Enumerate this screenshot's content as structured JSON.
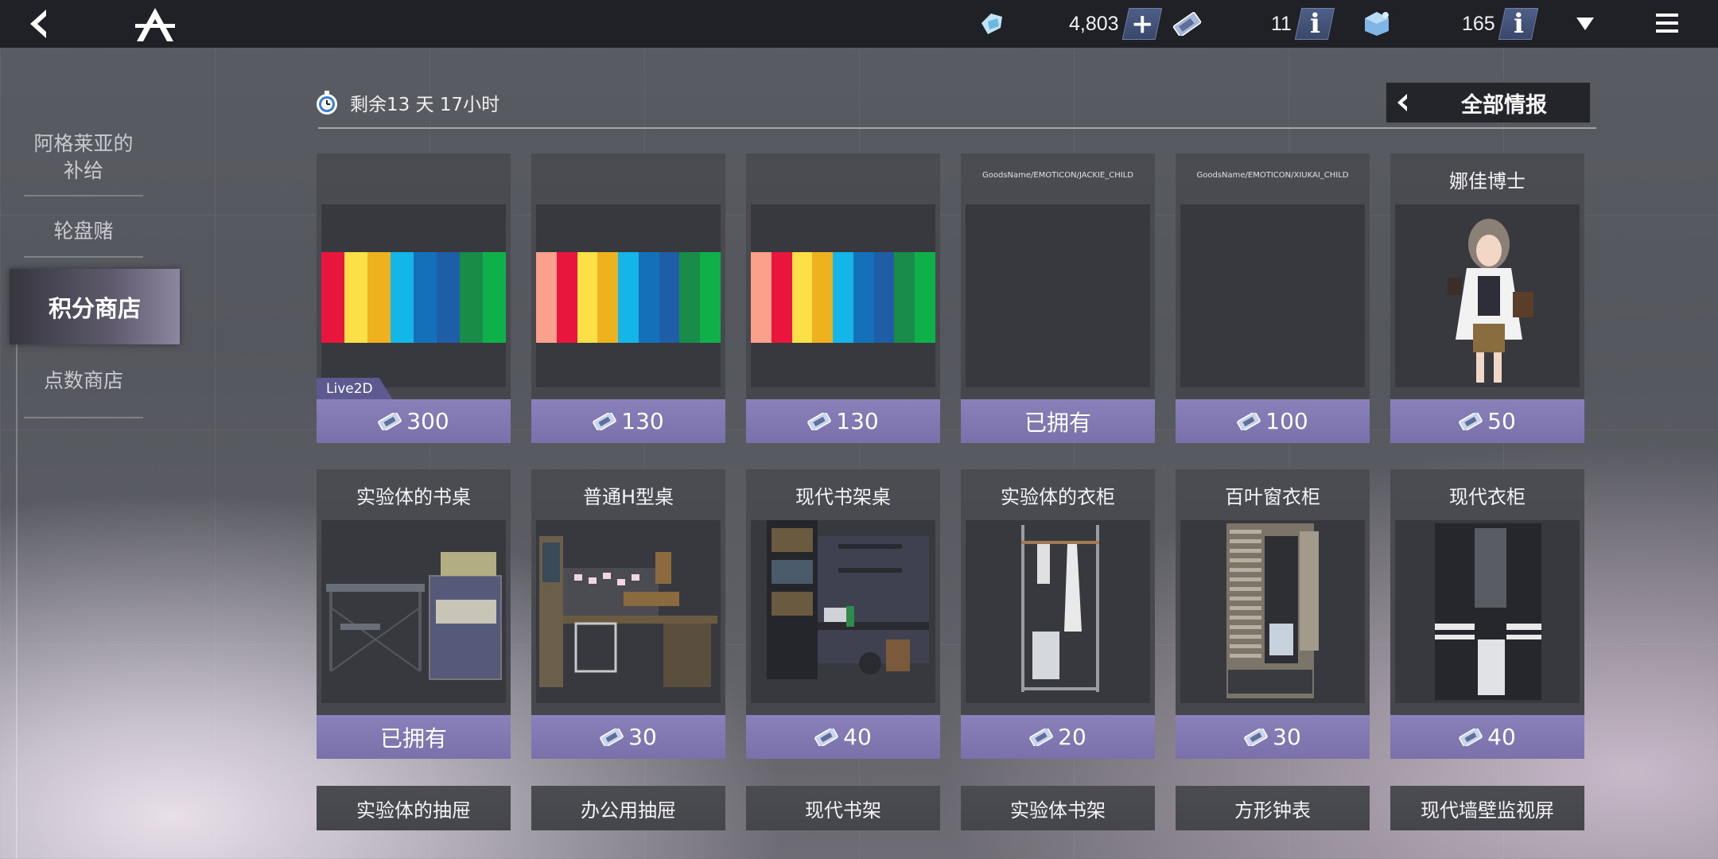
{
  "topbar": {
    "crystals": "4,803",
    "tickets": "11",
    "cubes": "165",
    "plus_label": "+",
    "info_label": "i"
  },
  "nav": {
    "items": [
      {
        "label": "阿格莱亚的\n补给"
      },
      {
        "label": "轮盘赌"
      },
      {
        "label": "积分商店"
      },
      {
        "label": "点数商店"
      }
    ],
    "active_index": 2
  },
  "header": {
    "timer": "剩余13 天 17小时",
    "info_all": "全部情报"
  },
  "products_row1": [
    {
      "title": "",
      "price": "300",
      "tag": "Live2D",
      "bars": [
        "#e8153c",
        "#fde048",
        "#efb21f",
        "#14b6ea",
        "#1470b9",
        "#1f5ea6",
        "#1a8c4a",
        "#0fb04a"
      ]
    },
    {
      "title": "",
      "price": "130",
      "bars": [
        "#fba08a",
        "#e8153c",
        "#fde048",
        "#efb21f",
        "#14b6ea",
        "#1470b9",
        "#1f5ea6",
        "#1a8c4a",
        "#0fb04a"
      ]
    },
    {
      "title": "",
      "price": "130",
      "bars": [
        "#fba08a",
        "#e8153c",
        "#fde048",
        "#efb21f",
        "#14b6ea",
        "#1470b9",
        "#1f5ea6",
        "#1a8c4a",
        "#0fb04a"
      ]
    },
    {
      "title": "GoodsName/EMOTICON/JACKIE_CHILD",
      "price": "已拥有"
    },
    {
      "title": "GoodsName/EMOTICON/XIUKAI_CHILD",
      "price": "100"
    },
    {
      "title": "娜佳博士",
      "price": "50"
    }
  ],
  "products_row2": [
    {
      "title": "实验体的书桌",
      "price": "已拥有"
    },
    {
      "title": "普通H型桌",
      "price": "30"
    },
    {
      "title": "现代书架桌",
      "price": "40"
    },
    {
      "title": "实验体的衣柜",
      "price": "20"
    },
    {
      "title": "百叶窗衣柜",
      "price": "30"
    },
    {
      "title": "现代衣柜",
      "price": "40"
    }
  ],
  "products_row3": [
    {
      "title": "实验体的抽屉"
    },
    {
      "title": "办公用抽屉"
    },
    {
      "title": "现代书架"
    },
    {
      "title": "实验体书架"
    },
    {
      "title": "方形钟表"
    },
    {
      "title": "现代墙壁监视屏"
    }
  ]
}
